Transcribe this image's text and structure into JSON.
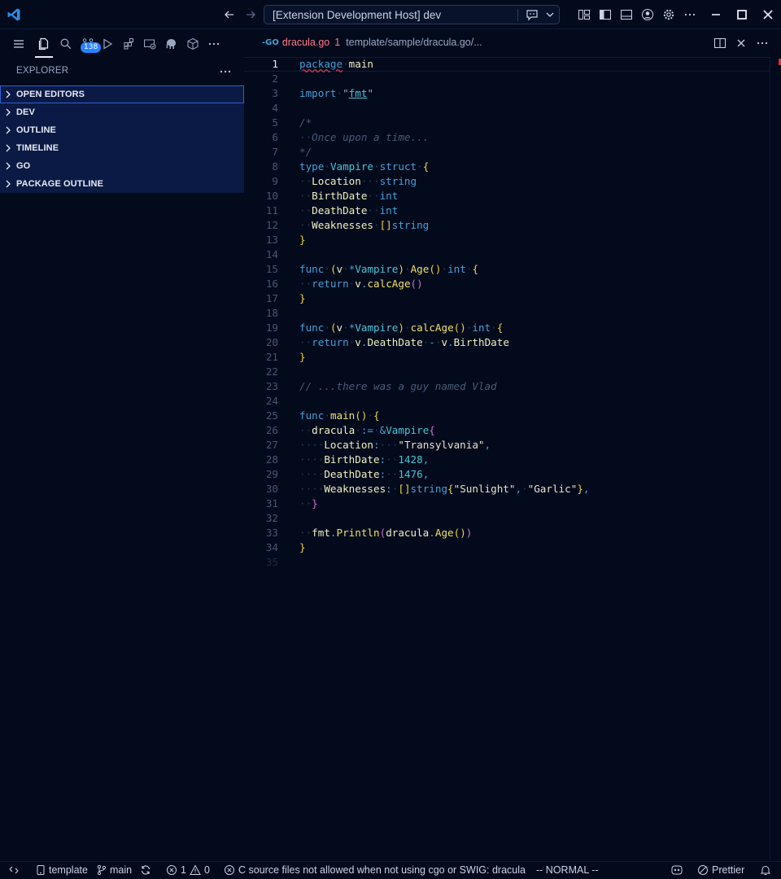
{
  "title": {
    "command_center": "[Extension Development Host] dev"
  },
  "activity_bar": {
    "source_control_badge": "138"
  },
  "sidebar": {
    "title": "EXPLORER",
    "sections": [
      {
        "label": "OPEN EDITORS"
      },
      {
        "label": "DEV"
      },
      {
        "label": "OUTLINE"
      },
      {
        "label": "TIMELINE"
      },
      {
        "label": "GO"
      },
      {
        "label": "PACKAGE OUTLINE"
      }
    ]
  },
  "tab": {
    "lang_icon": "-GO",
    "filename": "dracula.go",
    "problem_count": "1",
    "path": "template/sample/dracula.go/..."
  },
  "editor": {
    "lines": [
      "1",
      "2",
      "3",
      "4",
      "5",
      "6",
      "7",
      "8",
      "9",
      "10",
      "11",
      "12",
      "13",
      "14",
      "15",
      "16",
      "17",
      "18",
      "19",
      "20",
      "21",
      "22",
      "23",
      "24",
      "25",
      "26",
      "27",
      "28",
      "29",
      "30",
      "31",
      "32",
      "33",
      "34",
      "35"
    ],
    "code": {
      "package_kw": "package",
      "package_name": "main",
      "import_kw": "import",
      "import_path": "fmt",
      "comment_open": "/*",
      "comment_body": "Once upon a time...",
      "comment_close": "*/",
      "type_kw": "type",
      "struct_name": "Vampire",
      "struct_kw": "struct",
      "field_location": "Location",
      "field_birth": "BirthDate",
      "field_death": "DeathDate",
      "field_weak": "Weaknesses",
      "type_string": "string",
      "type_int": "int",
      "func_kw": "func",
      "recv": "v",
      "method_age": "Age",
      "method_calc": "calcAge",
      "return_kw": "return",
      "line_comment": "// ...there was a guy named Vlad",
      "main_fn": "main",
      "var_dracula": "dracula",
      "op_assign": ":=",
      "val_location": "\"Transylvania\"",
      "val_birth": "1428",
      "val_death": "1476",
      "val_sunlight": "\"Sunlight\"",
      "val_garlic": "\"Garlic\"",
      "pkg_fmt": "fmt",
      "fn_println": "Println"
    }
  },
  "status_bar": {
    "project": "template",
    "branch": "main",
    "errors": "1",
    "warnings": "0",
    "message": "C source files not allowed when not using cgo or SWIG: dracula",
    "mode": "-- NORMAL --",
    "formatter": "Prettier"
  },
  "colors": {
    "background": "#020a1c",
    "sidebar_section": "#0b1a44",
    "accent": "#2684ff",
    "keyword": "#4a9fd6",
    "function": "#f0e06a",
    "error": "#ff7a8a"
  },
  "icons": [
    "vscode-logo-icon",
    "arrow-left-icon",
    "arrow-right-icon",
    "copilot-icon",
    "layout-icon",
    "sidebar-toggle-icon",
    "panel-toggle-icon",
    "account-icon",
    "gear-icon",
    "more-icon",
    "minimize-icon",
    "maximize-icon",
    "close-icon",
    "menu-icon",
    "files-icon",
    "search-icon",
    "source-control-icon",
    "run-debug-icon",
    "extensions-icon",
    "remote-icon",
    "elephant-icon",
    "box-icon",
    "split-editor-icon",
    "remote-status-icon",
    "device-icon",
    "branch-icon",
    "sync-icon",
    "error-icon",
    "warning-icon",
    "copilot-status-icon",
    "prohibited-icon",
    "bell-icon"
  ]
}
